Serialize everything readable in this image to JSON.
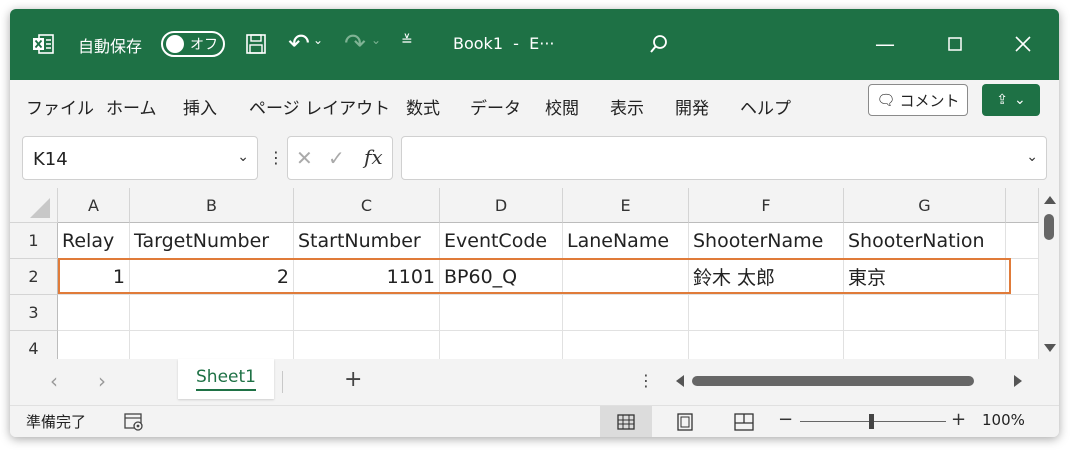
{
  "titlebar": {
    "autosave_label": "自動保存",
    "autosave_state": "オフ",
    "title": "Book1  -  E···",
    "icons": [
      "excel-logo-icon",
      "save-icon",
      "undo-icon",
      "redo-icon",
      "customize-qat-icon",
      "search-icon",
      "minimize-icon",
      "maximize-icon",
      "close-icon"
    ]
  },
  "menu": {
    "items": [
      "ファイル",
      "ホーム",
      "挿入",
      "ページ レイアウト",
      "数式",
      "データ",
      "校閲",
      "表示",
      "開発",
      "ヘルプ"
    ],
    "comment_label": "コメント",
    "share_label": "⌄"
  },
  "formula": {
    "name_box": "K14",
    "fx": "fx",
    "value": ""
  },
  "grid": {
    "columns": [
      "A",
      "B",
      "C",
      "D",
      "E",
      "F",
      "G"
    ],
    "rows": [
      "1",
      "2",
      "3",
      "4"
    ],
    "cells": [
      [
        "Relay",
        "TargetNumber",
        "StartNumber",
        "EventCode",
        "LaneName",
        "ShooterName",
        "ShooterNation"
      ],
      [
        "1",
        "2",
        "1101",
        "BP60_Q",
        "",
        "鈴木 太郎",
        "東京"
      ],
      [
        "",
        "",
        "",
        "",
        "",
        "",
        ""
      ],
      [
        "",
        "",
        "",
        "",
        "",
        "",
        ""
      ]
    ]
  },
  "sheets": {
    "tabs": [
      "Sheet1"
    ],
    "add": "+"
  },
  "status": {
    "ready": "準備完了",
    "zoom_minus": "−",
    "zoom_plus": "+",
    "zoom": "100%"
  },
  "colors": {
    "brand": "#1e7145",
    "highlight": "#e07b39"
  }
}
